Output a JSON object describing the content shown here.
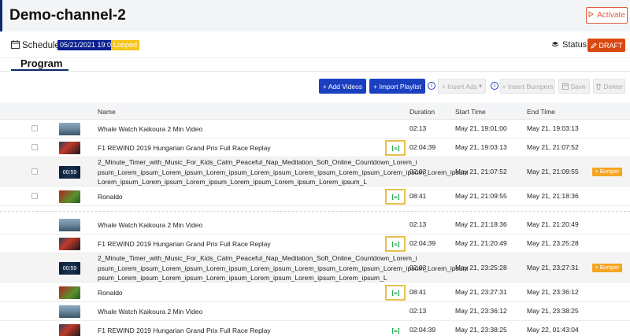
{
  "header": {
    "title": "Demo-channel-2",
    "activate_label": "Activate",
    "activate_color": "#e05a3a"
  },
  "schedule": {
    "label": "Schedule",
    "date": "05/21/2021 19:01",
    "looped": "Looped",
    "status_label": "Status",
    "draft_label": "DRAFT"
  },
  "tabs": {
    "program": "Program"
  },
  "toolbar": {
    "add_videos": "+ Add Videos",
    "import_playlist": "+ Import Playlist",
    "insert_ads": "+ Insert Ads",
    "insert_bumpers": "+ Insert Bumpers",
    "save": "Save",
    "delete": "Delete"
  },
  "columns": {
    "name": "Name",
    "duration": "Duration",
    "start": "Start Time",
    "end": "End Time"
  },
  "bumper_label": "+ Bumper",
  "rows": [
    {
      "name": [
        "Whale Watch Kaikoura 2 Min Video"
      ],
      "duration": "02:13",
      "start": "May 21, 19:01:00",
      "end": "May 21, 19:03:13",
      "checkbox": true,
      "thumb": "whale",
      "sched": "none",
      "bumper": false
    },
    {
      "name": [
        "F1 REWIND 2019 Hungarian Grand Prix Full Race Replay"
      ],
      "duration": "02:04:39",
      "start": "May 21, 19:03:13",
      "end": "May 21, 21:07:52",
      "checkbox": true,
      "thumb": "f1",
      "sched": "highlight",
      "bumper": false
    },
    {
      "name": [
        "2_Minute_Timer_with_Music_For_Kids_Calm_Peaceful_Nap_Meditation_Soft_Online_Countdown_Lorem_i",
        "psum_Lorem_ipsum_Lorem_ipsum_Lorem_ipsum_Lorem_ipsum_Lorem_ipsum_Lorem_ipsum_Lorem_ipsum_Lorem_ipsum",
        "Lorem_ipsum_Lorem_ipsum_Lorem_ipsum_Lorem_ipsum_Lorem_ipsum_Lorem_ipsum_L"
      ],
      "duration": "02:03",
      "start": "May 21, 21:07:52",
      "end": "May 21, 21:09:55",
      "checkbox": true,
      "thumb": "timer",
      "sched": "none",
      "bumper": true
    },
    {
      "name": [
        "Ronaldo"
      ],
      "duration": "08:41",
      "start": "May 21, 21:09:55",
      "end": "May 21, 21:18:36",
      "checkbox": true,
      "thumb": "ronaldo",
      "sched": "highlight",
      "bumper": false
    },
    {
      "name": [
        "Whale Watch Kaikoura 2 Min Video"
      ],
      "duration": "02:13",
      "start": "May 21, 21:18:36",
      "end": "May 21, 21:20:49",
      "checkbox": false,
      "thumb": "whale",
      "sched": "none",
      "bumper": false
    },
    {
      "name": [
        "F1 REWIND 2019 Hungarian Grand Prix Full Race Replay"
      ],
      "duration": "02:04:39",
      "start": "May 21, 21:20:49",
      "end": "May 21, 23:25:28",
      "checkbox": false,
      "thumb": "f1",
      "sched": "highlight",
      "bumper": false
    },
    {
      "name": [
        "2_Minute_Timer_with_Music_For_Kids_Calm_Peaceful_Nap_Meditation_Soft_Online_Countdown_Lorem_i",
        "psum_Lorem_ipsum_Lorem_ipsum_Lorem_ipsum_Lorem_ipsum_Lorem_ipsum_Lorem_ipsum_Lorem_ipsum_Lorem_ipsum",
        "psum_Lorem_ipsum_Lorem_ipsum_Lorem_ipsum_Lorem_ipsum_Lorem_ipsum_Lorem_ipsum_L"
      ],
      "duration": "02:03",
      "start": "May 21, 23:25:28",
      "end": "May 21, 23:27:31",
      "checkbox": false,
      "thumb": "timer",
      "sched": "none",
      "bumper": true
    },
    {
      "name": [
        "Ronaldo"
      ],
      "duration": "08:41",
      "start": "May 21, 23:27:31",
      "end": "May 21, 23:36:12",
      "checkbox": false,
      "thumb": "ronaldo",
      "sched": "highlight",
      "bumper": false
    },
    {
      "name": [
        "Whale Watch Kaikoura 2 Min Video"
      ],
      "duration": "02:13",
      "start": "May 21, 23:36:12",
      "end": "May 21, 23:38:25",
      "checkbox": false,
      "thumb": "whale",
      "sched": "none",
      "bumper": false
    },
    {
      "name": [
        "F1 REWIND 2019 Hungarian Grand Prix Full Race Replay"
      ],
      "duration": "02:04:39",
      "start": "May 21, 23:38:25",
      "end": "May 22, 01:43:04",
      "checkbox": false,
      "thumb": "f1",
      "sched": "bare",
      "bumper": false
    }
  ],
  "colors": {
    "primary_button": "#1a3fbf",
    "draft": "#d9480f",
    "bumper": "#f5a623",
    "date_badge": "#0a1f8f",
    "looped_badge": "#f5c518",
    "schedule_icon": "#1aa34a",
    "highlight": "#e8c24a"
  },
  "icons": {
    "calendar": "calendar-icon",
    "status": "layers-icon",
    "draft": "pencil-icon",
    "activate": "play-outline-icon",
    "info": "info-circle-icon",
    "save": "floppy-disk-icon",
    "delete": "trash-icon",
    "schedule_marker": "bracket-code-icon"
  }
}
